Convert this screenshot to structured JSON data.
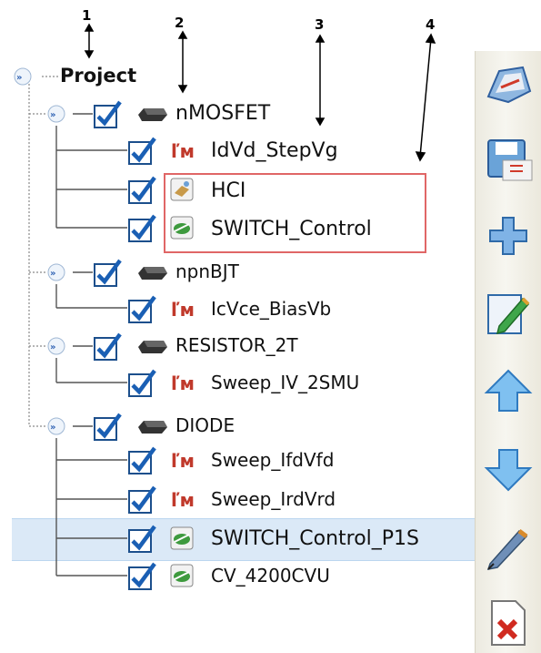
{
  "callouts": [
    "1",
    "2",
    "3",
    "4"
  ],
  "tree": {
    "root": "Project",
    "devices": [
      {
        "name": "nMOSFET",
        "tests": [
          "IdVd_StepVg",
          "HCI",
          "SWITCH_Control"
        ]
      },
      {
        "name": "npnBJT",
        "tests": [
          "IcVce_BiasVb"
        ]
      },
      {
        "name": "RESISTOR_2T",
        "tests": [
          "Sweep_IV_2SMU"
        ]
      },
      {
        "name": "DIODE",
        "tests": [
          "Sweep_IfdVfd",
          "Sweep_IrdVrd",
          "SWITCH_Control_P1S",
          "CV_4200CVU"
        ]
      }
    ]
  },
  "toolbar_icons": [
    "open-project-icon",
    "save-project-icon",
    "add-icon",
    "edit-icon",
    "move-up-icon",
    "move-down-icon",
    "rename-icon",
    "delete-icon"
  ],
  "colors": {
    "selection": "#dbe9f7",
    "highlight_border": "#e06666",
    "checkbox_check": "#1a5fb4"
  }
}
